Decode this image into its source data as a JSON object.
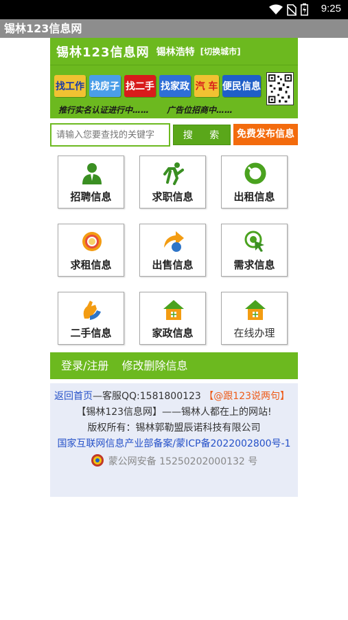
{
  "status_bar": {
    "time": "9:25"
  },
  "window": {
    "title": "锡林123信息网"
  },
  "header": {
    "site_name": "锡林123信息网",
    "city": "锡林浩特",
    "switch_city": "[切换城市]"
  },
  "banner": {
    "tags": [
      {
        "label": "找工作",
        "bg": "#f1c232",
        "fg": "#1a3aa8"
      },
      {
        "label": "找房子",
        "bg": "#4a9ee8",
        "fg": "#ffffff"
      },
      {
        "label": "找二手",
        "bg": "#d81b1b",
        "fg": "#ffffff"
      },
      {
        "label": "找家政",
        "bg": "#2e6fd6",
        "fg": "#ffffff"
      },
      {
        "label": "汽 车",
        "bg": "#f1c232",
        "fg": "#d81b1b"
      },
      {
        "label": "便民信息",
        "bg": "#1f5fc8",
        "fg": "#ffffff"
      }
    ],
    "line1": "推行实名认证进行中……",
    "line2": "广告位招商中……"
  },
  "search": {
    "placeholder": "请输入您要查找的关键字",
    "button_label": "搜 索",
    "post_label": "免费发布信息"
  },
  "categories": [
    {
      "label": "招聘信息",
      "icon": "person-icon"
    },
    {
      "label": "求职信息",
      "icon": "runner-icon"
    },
    {
      "label": "出租信息",
      "icon": "ring-icon"
    },
    {
      "label": "求租信息",
      "icon": "orb-icon"
    },
    {
      "label": "出售信息",
      "icon": "arrow-icon"
    },
    {
      "label": "需求信息",
      "icon": "target-icon"
    },
    {
      "label": "二手信息",
      "icon": "hand-icon"
    },
    {
      "label": "家政信息",
      "icon": "house-icon"
    },
    {
      "label": "在线办理",
      "icon": "house-icon"
    }
  ],
  "nav": {
    "login_register": "登录/注册",
    "edit_delete": "修改删除信息"
  },
  "footer": {
    "home_link": "返回首页",
    "service": "—客服QQ:1581800123",
    "chat_link": "【@跟123说两句】",
    "slogan": "【锡林123信息网】——锡林人都在上的网站!",
    "copyright": "版权所有：锡林郭勒盟辰诺科技有限公司",
    "icp": "国家互联网信息产业部备案/蒙ICP备2022002800号-1",
    "police": "蒙公网安备 15250202000132 号"
  },
  "colors": {
    "brand_green": "#6cb91f",
    "post_orange": "#f36b0d",
    "link_blue": "#2450c8"
  }
}
